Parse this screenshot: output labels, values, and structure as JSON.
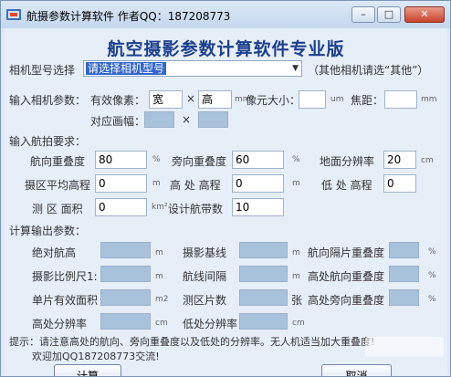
{
  "window": {
    "title": "航摄参数计算软件  作者QQ：187208773",
    "min_label": "–",
    "max_label": "□",
    "close_label": "✕"
  },
  "app": {
    "heading": "航空摄影参数计算软件专业版"
  },
  "camera": {
    "label": "相机型号选择",
    "selected": "请选择相机型号",
    "hint": "（其他相机请选“其他”）"
  },
  "input_camera": {
    "section": "输入相机参数：",
    "pixels_label": "有效像素：",
    "width_value": "宽",
    "times": "×",
    "height_value": "高",
    "unit_mm": "mm",
    "pixel_size_label": "像元大小：",
    "pixel_size_value": "",
    "unit_um": "um",
    "focal_label": "焦距：",
    "focal_value": "",
    "unit_mm2": "mm",
    "frame_label": "对应画幅：",
    "frame_times": "×"
  },
  "flight": {
    "section": "输入航拍要求：",
    "fwd_overlap_label": "航向重叠度",
    "fwd_overlap_value": "80",
    "pct1": "%",
    "side_overlap_label": "旁向重叠度",
    "side_overlap_value": "60",
    "pct2": "%",
    "gsd_label": "地面分辨率",
    "gsd_value": "20",
    "unit_cm": "cm",
    "avg_elev_label": "摄区平均高程",
    "avg_elev_value": "0",
    "unit_m1": "m",
    "high_elev_label": "高 处 高程",
    "high_elev_value": "0",
    "unit_m2": "m",
    "low_elev_label": "低 处 高程",
    "low_elev_value": "0",
    "area_label": "测 区 面积",
    "area_value": "0",
    "unit_km2": "km²",
    "strips_label": "设计航带数",
    "strips_value": "10"
  },
  "output": {
    "section": "计算输出参数：",
    "abs_alt_label": "绝对航高",
    "unit_m_a": "m",
    "baseline_label": "摄影基线",
    "unit_m_b": "m",
    "adj_overlap_label": "航向隔片重叠度",
    "pct_a": "%",
    "scale_label": "摄影比例尺1:",
    "unit_m_c": "m",
    "line_spacing_label": "航线间隔",
    "unit_m_d": "m",
    "high_fwd_label": "高处航向重叠度",
    "pct_b": "%",
    "single_area_label": "单片有效面积",
    "unit_m2": "m2",
    "photo_count_label": "测区片数",
    "unit_zhang": "张",
    "high_side_label": "高处旁向重叠度",
    "pct_c": "%",
    "high_res_label": "高处分辨率",
    "unit_cm_a": "cm",
    "low_res_label": "低处分辨率",
    "unit_cm_b": "cm"
  },
  "tips": {
    "line1": "提示：请注意高处的航向、旁向重叠度以及低处的分辨率。无人机适当加大重叠度!",
    "line2": "欢迎加QQ187208773交流!"
  },
  "buttons": {
    "calc": "计算",
    "cancel": "取消"
  },
  "colors": {
    "heading": "#1c3f8e",
    "output_field": "#a9c2dc",
    "selection": "#3366cc"
  }
}
